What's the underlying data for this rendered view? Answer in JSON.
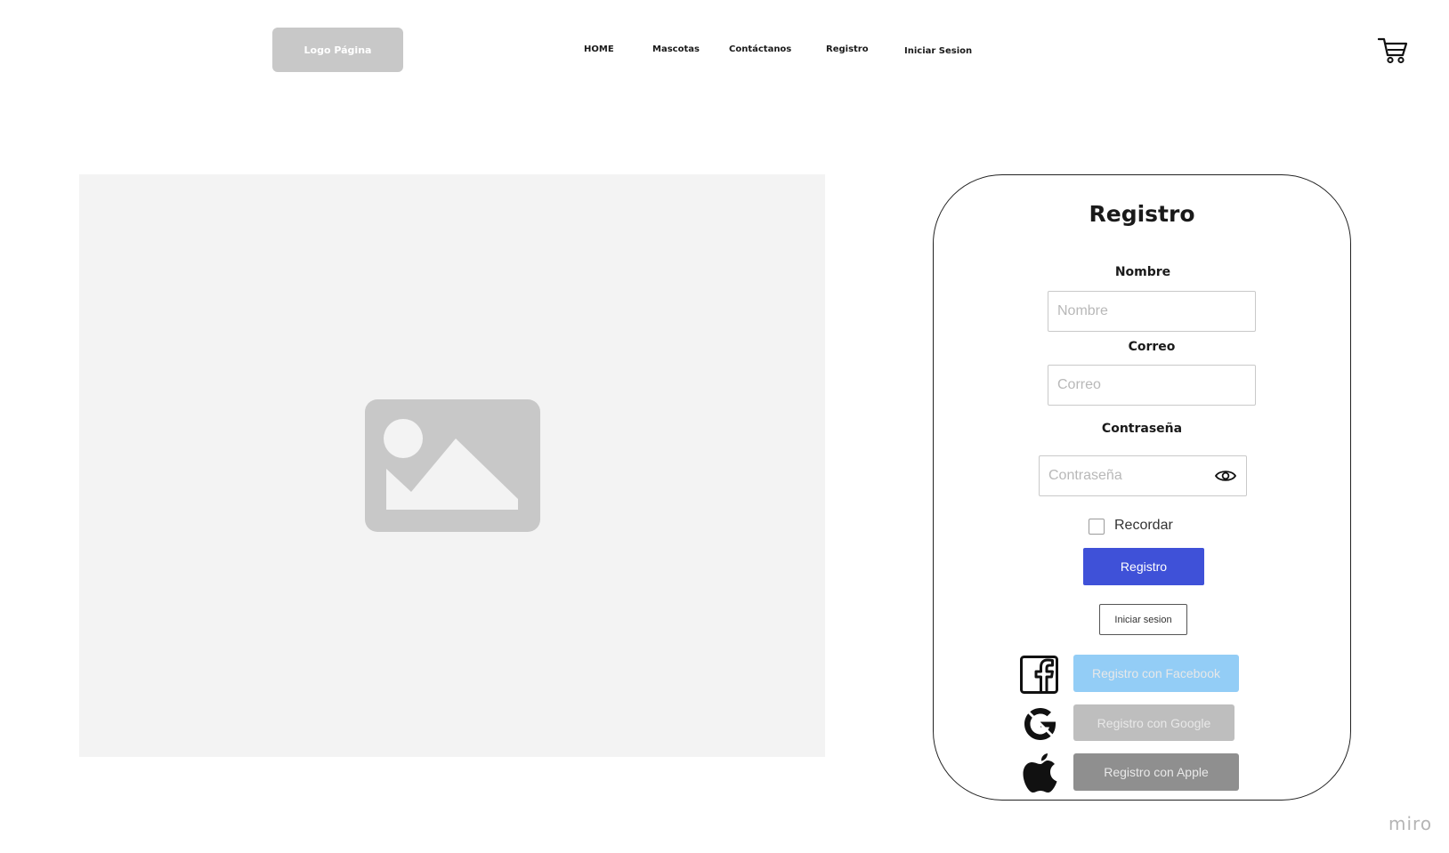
{
  "header": {
    "logo_label": "Logo Página",
    "nav": [
      "HOME",
      "Mascotas",
      "Contáctanos",
      "Registro",
      "Iniciar Sesion"
    ],
    "cart_icon": "cart-icon"
  },
  "hero": {
    "icon": "image-placeholder-icon",
    "background": "#f3f3f3"
  },
  "form": {
    "title": "Registro",
    "name_label": "Nombre",
    "name_placeholder": "Nombre",
    "email_label": "Correo",
    "email_placeholder": "Correo",
    "password_label": "Contraseña",
    "password_placeholder": "Contraseña",
    "password_toggle_icon": "eye-icon",
    "remember_label": "Recordar",
    "submit_label": "Registro",
    "login_label": "Iniciar sesion",
    "social": [
      {
        "label": "Registro con Facebook",
        "icon": "facebook-icon",
        "color": "#93cdf6"
      },
      {
        "label": "Registro con Google",
        "icon": "google-icon",
        "color": "#bebebe"
      },
      {
        "label": "Registro con Apple",
        "icon": "apple-icon",
        "color": "#8f8f8f"
      }
    ]
  },
  "colors": {
    "accent": "#3f51d8",
    "logo_bg": "#c8c8c8"
  },
  "watermark": "miro"
}
